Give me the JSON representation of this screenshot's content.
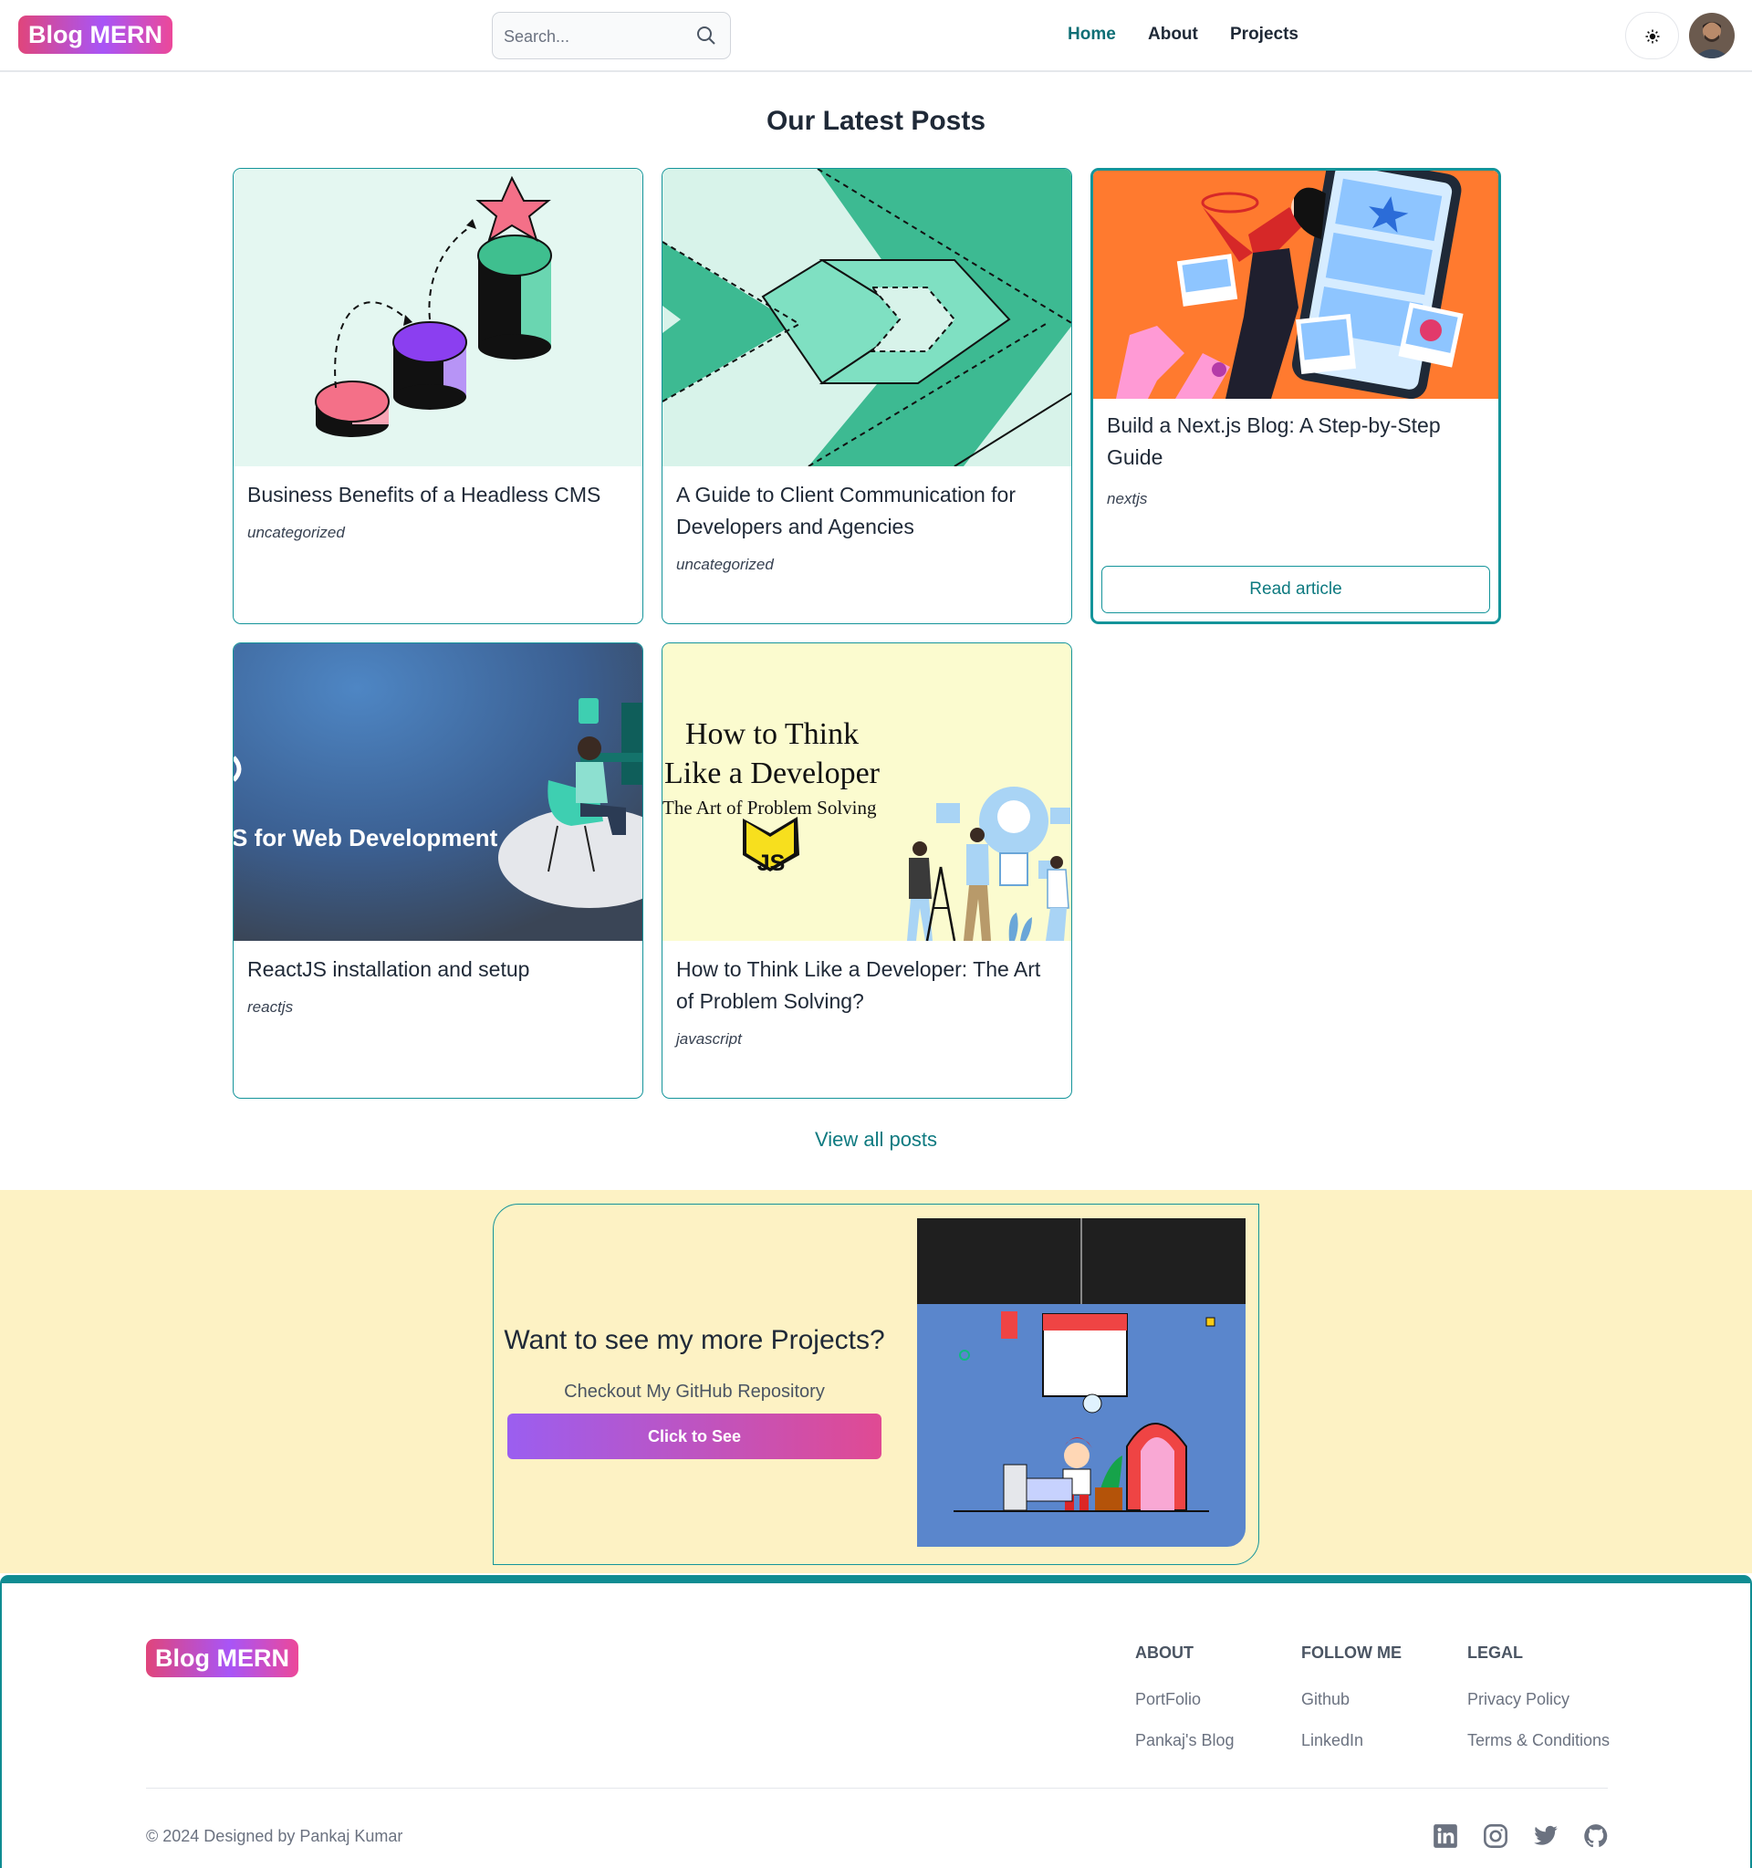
{
  "header": {
    "logo": "Blog MERN",
    "search_placeholder": "Search...",
    "nav": [
      "Home",
      "About",
      "Projects"
    ]
  },
  "posts_section": {
    "title": "Our Latest Posts",
    "posts": [
      {
        "title": "Business Benefits of a Headless CMS",
        "category": "uncategorized"
      },
      {
        "title": "A Guide to Client Communication for Developers and Agencies",
        "category": "uncategorized"
      },
      {
        "title": "Build a Next.js Blog: A Step-by-Step Guide",
        "category": "nextjs",
        "button": "Read article"
      },
      {
        "title": "ReactJS installation and setup",
        "category": "reactjs",
        "image_text": "S for Web Development"
      },
      {
        "title": "How to Think Like a Developer: The Art of Problem Solving?",
        "category": "javascript",
        "image_text": [
          "How to Think",
          "Like a Developer",
          "The Art of Problem Solving"
        ],
        "badge": "JS"
      }
    ],
    "view_all": "View all posts"
  },
  "cta": {
    "title": "Want to see my more Projects?",
    "subtitle": "Checkout My GitHub Repository",
    "button": "Click to See"
  },
  "footer": {
    "logo": "Blog MERN",
    "columns": [
      {
        "title": "ABOUT",
        "links": [
          "PortFolio",
          "Pankaj's Blog"
        ]
      },
      {
        "title": "FOLLOW ME",
        "links": [
          "Github",
          "LinkedIn"
        ]
      },
      {
        "title": "LEGAL",
        "links": [
          "Privacy Policy",
          "Terms & Conditions"
        ]
      }
    ],
    "copyright": "© 2024 Designed by Pankaj Kumar",
    "social_icons": [
      "linkedin-icon",
      "instagram-icon",
      "twitter-icon",
      "github-icon"
    ]
  },
  "colors": {
    "brand_teal": "#0f8c92",
    "logo_gradient": [
      "#e0457b",
      "#a855f7",
      "#ec4899"
    ],
    "cta_background": "#fdf2c4"
  }
}
